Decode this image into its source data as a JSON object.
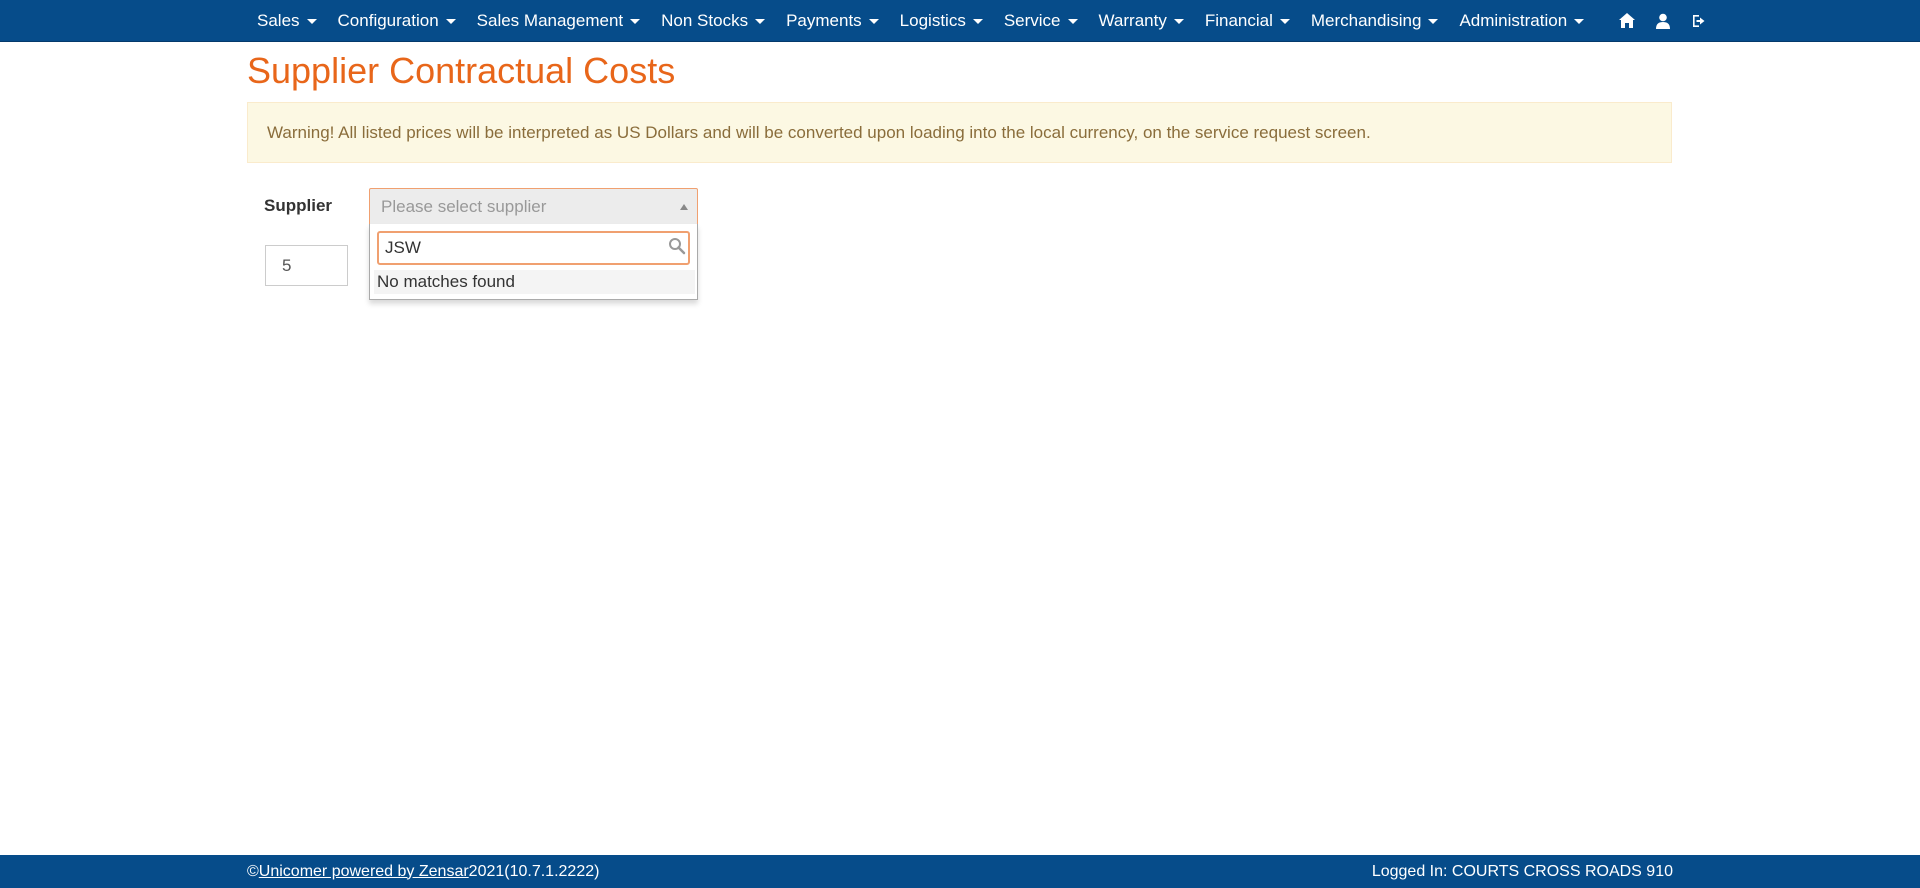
{
  "nav": {
    "items": [
      {
        "label": "Sales"
      },
      {
        "label": "Configuration"
      },
      {
        "label": "Sales Management"
      },
      {
        "label": "Non Stocks"
      },
      {
        "label": "Payments"
      },
      {
        "label": "Logistics"
      },
      {
        "label": "Service"
      },
      {
        "label": "Warranty"
      },
      {
        "label": "Financial"
      },
      {
        "label": "Merchandising"
      },
      {
        "label": "Administration"
      }
    ],
    "icons": [
      "home-icon",
      "user-icon",
      "logout-icon"
    ]
  },
  "page": {
    "title": "Supplier Contractual Costs",
    "warning": "Warning! All listed prices will be interpreted as US Dollars and will be converted upon loading into the local currency, on the service request screen."
  },
  "form": {
    "supplier_label": "Supplier",
    "supplier_placeholder": "Please select supplier",
    "search_value": "JSW",
    "no_matches": "No matches found",
    "page_size_value": "5"
  },
  "footer": {
    "copyright": "©",
    "link_text": "Unicomer powered by Zensar",
    "year": "2021",
    "version": "(10.7.1.2222)",
    "logged_in": "Logged In: COURTS CROSS ROADS 910"
  },
  "colors": {
    "nav_bg": "#064c8a",
    "title": "#e8661a",
    "warning_bg": "#fcf8e3",
    "warning_text": "#8a6d3b"
  }
}
